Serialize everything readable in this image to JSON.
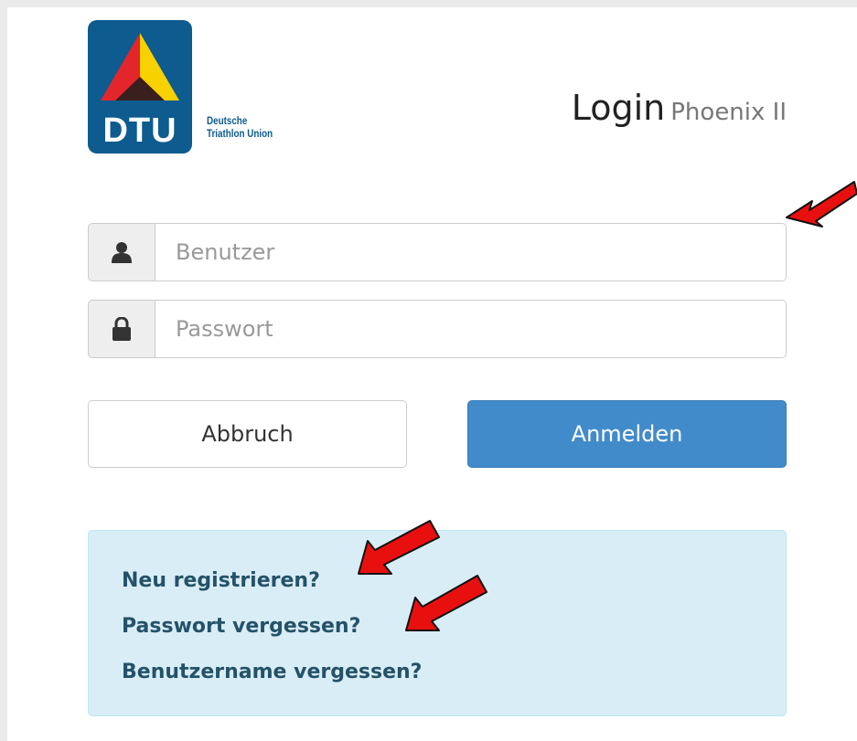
{
  "logo": {
    "abbreviation": "DTU",
    "name_line1": "Deutsche",
    "name_line2": "Triathlon Union",
    "colors": {
      "background": "#0d5b8f",
      "red": "#e3262b",
      "yellow": "#f7d100",
      "dark": "#3a1f1f"
    }
  },
  "header": {
    "title": "Login",
    "subtitle": "Phoenix II"
  },
  "form": {
    "username": {
      "placeholder": "Benutzer",
      "value": "",
      "icon": "user-icon"
    },
    "password": {
      "placeholder": "Passwort",
      "value": "",
      "icon": "lock-icon"
    },
    "cancel_label": "Abbruch",
    "login_label": "Anmelden"
  },
  "links": {
    "register": "Neu registrieren?",
    "forgot_password": "Passwort vergessen?",
    "forgot_username": "Benutzername vergessen?"
  },
  "annotations": {
    "arrow_color": "#e8100f",
    "arrow_outline": "#111111",
    "arrows": [
      "username-field",
      "register-link",
      "forgot-password-link"
    ]
  },
  "colors": {
    "accent": "#428bca",
    "info_background": "#d9edf7",
    "link_color": "#245269"
  }
}
